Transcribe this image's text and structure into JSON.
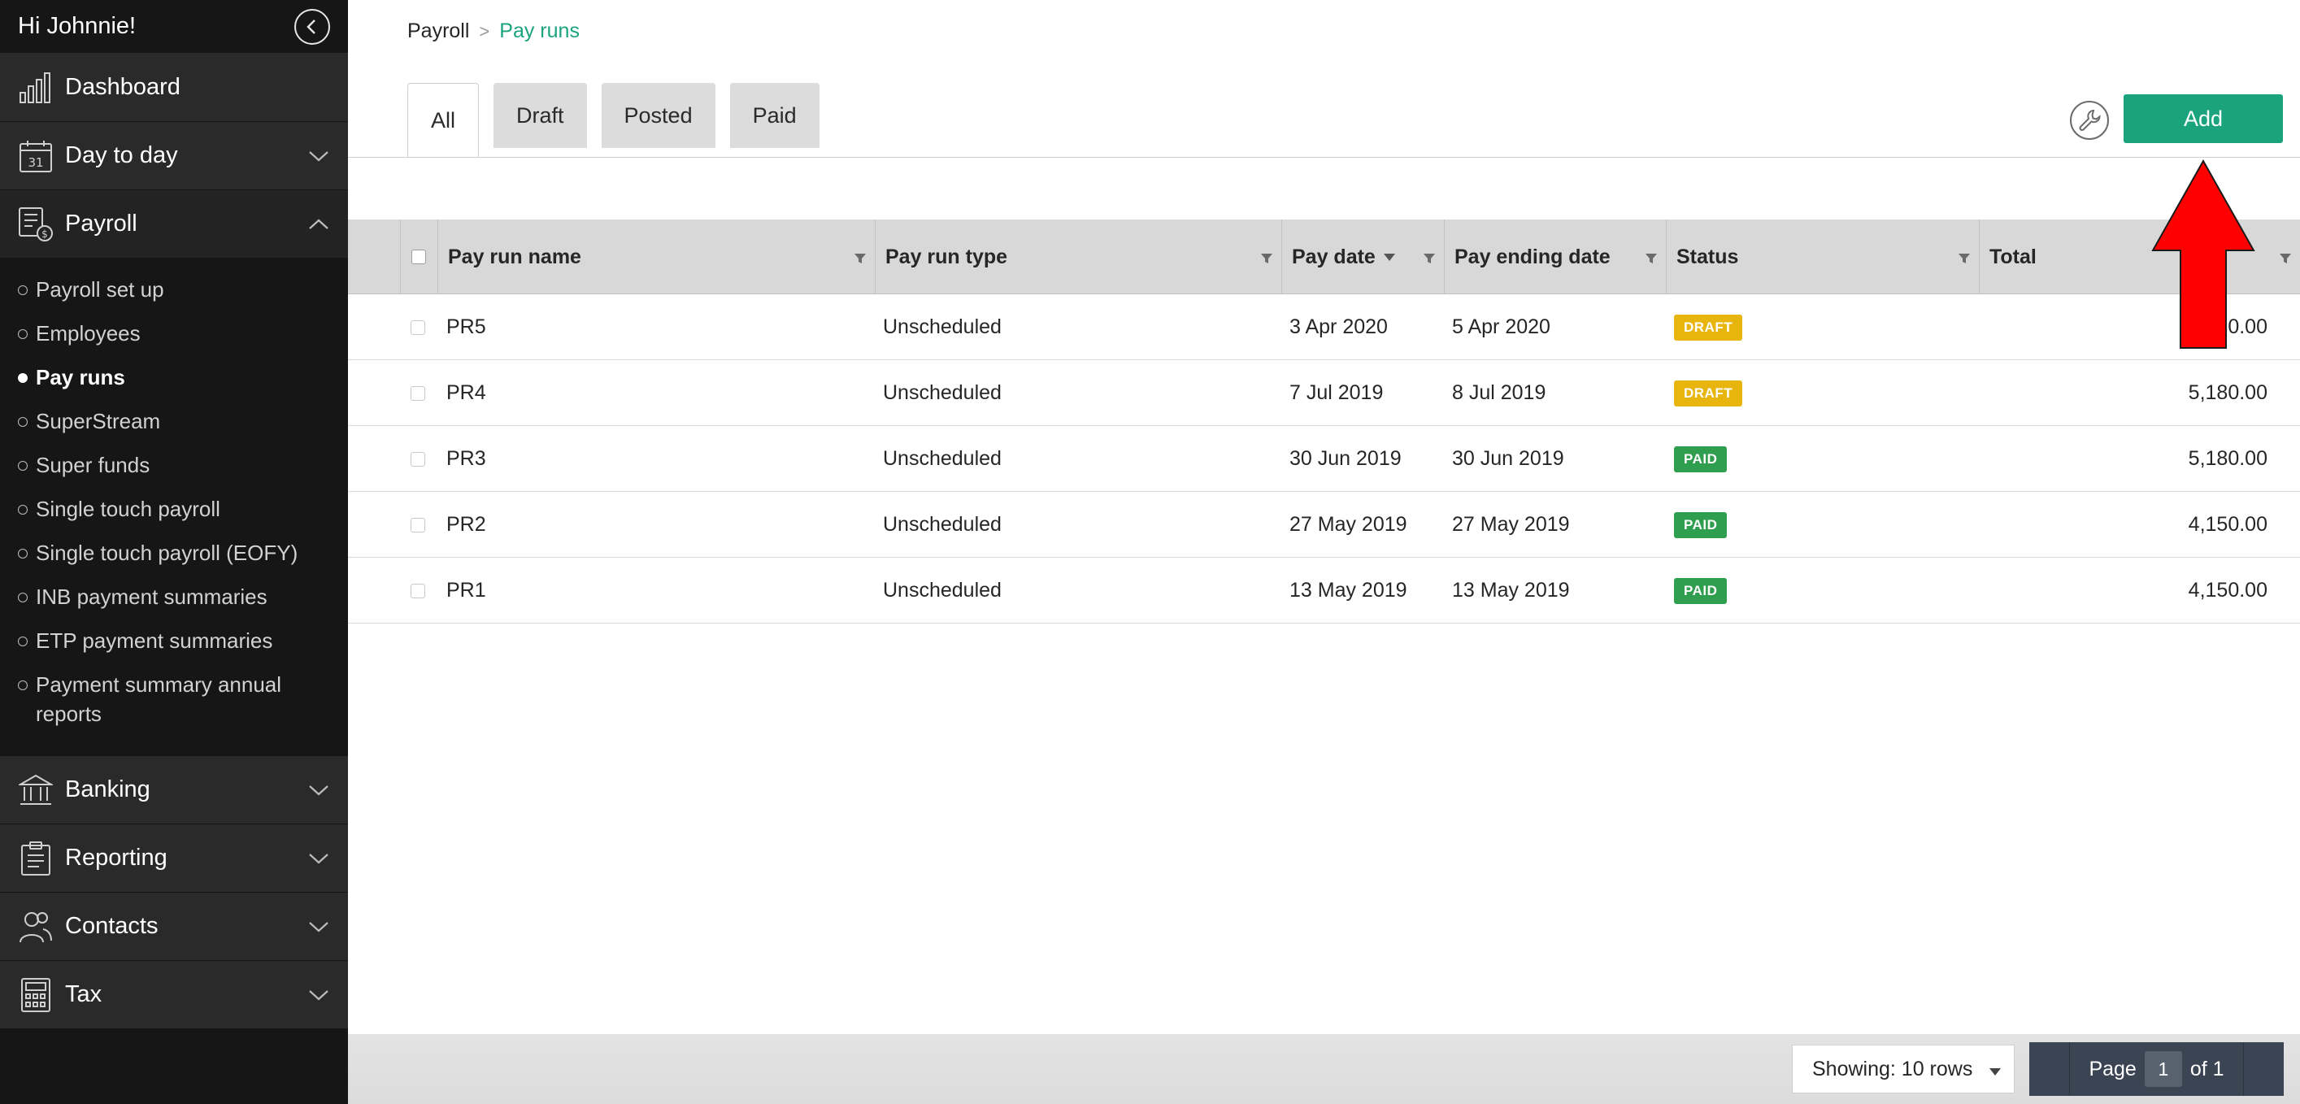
{
  "sidebar": {
    "greeting": "Hi Johnnie!",
    "nav": {
      "dashboard": "Dashboard",
      "day_to_day": "Day to day",
      "payroll": "Payroll",
      "banking": "Banking",
      "reporting": "Reporting",
      "contacts": "Contacts",
      "tax": "Tax"
    },
    "payroll_items": [
      "Payroll set up",
      "Employees",
      "Pay runs",
      "SuperStream",
      "Super funds",
      "Single touch payroll",
      "Single touch payroll (EOFY)",
      "INB payment summaries",
      "ETP payment summaries",
      "Payment summary annual reports"
    ],
    "active_item": "Pay runs",
    "calendar_day": "31"
  },
  "breadcrumb": {
    "root": "Payroll",
    "separator": ">",
    "current": "Pay runs"
  },
  "tabs": [
    "All",
    "Draft",
    "Posted",
    "Paid"
  ],
  "active_tab": "All",
  "toolbar": {
    "add_label": "Add"
  },
  "table": {
    "columns": [
      "Pay run name",
      "Pay run type",
      "Pay date",
      "Pay ending date",
      "Status",
      "Total"
    ],
    "rows": [
      {
        "name": "PR5",
        "type": "Unscheduled",
        "pay_date": "3 Apr 2020",
        "pay_ending_date": "5 Apr 2020",
        "status": "DRAFT",
        "total": "5,180.00"
      },
      {
        "name": "PR4",
        "type": "Unscheduled",
        "pay_date": "7 Jul 2019",
        "pay_ending_date": "8 Jul 2019",
        "status": "DRAFT",
        "total": "5,180.00"
      },
      {
        "name": "PR3",
        "type": "Unscheduled",
        "pay_date": "30 Jun 2019",
        "pay_ending_date": "30 Jun 2019",
        "status": "PAID",
        "total": "5,180.00"
      },
      {
        "name": "PR2",
        "type": "Unscheduled",
        "pay_date": "27 May 2019",
        "pay_ending_date": "27 May 2019",
        "status": "PAID",
        "total": "4,150.00"
      },
      {
        "name": "PR1",
        "type": "Unscheduled",
        "pay_date": "13 May 2019",
        "pay_ending_date": "13 May 2019",
        "status": "PAID",
        "total": "4,150.00"
      }
    ]
  },
  "footer": {
    "showing_label": "Showing: 10 rows",
    "page_label": "Page",
    "page_current": "1",
    "page_of": "of 1"
  },
  "colors": {
    "accent": "#1aa37c",
    "sidebar_bg": "#161616",
    "draft_badge": "#e8b50f",
    "paid_badge": "#2f9e4e",
    "annotation_arrow": "#ff0000"
  },
  "icons": {
    "collapse": "chevron-left-circle-icon",
    "dashboard": "bar-chart-icon",
    "day_to_day": "calendar-icon",
    "payroll": "payroll-document-icon",
    "banking": "bank-icon",
    "reporting": "clipboard-icon",
    "contacts": "people-icon",
    "tax": "calculator-icon",
    "settings": "wrench-icon",
    "filter": "filter-funnel-icon"
  }
}
